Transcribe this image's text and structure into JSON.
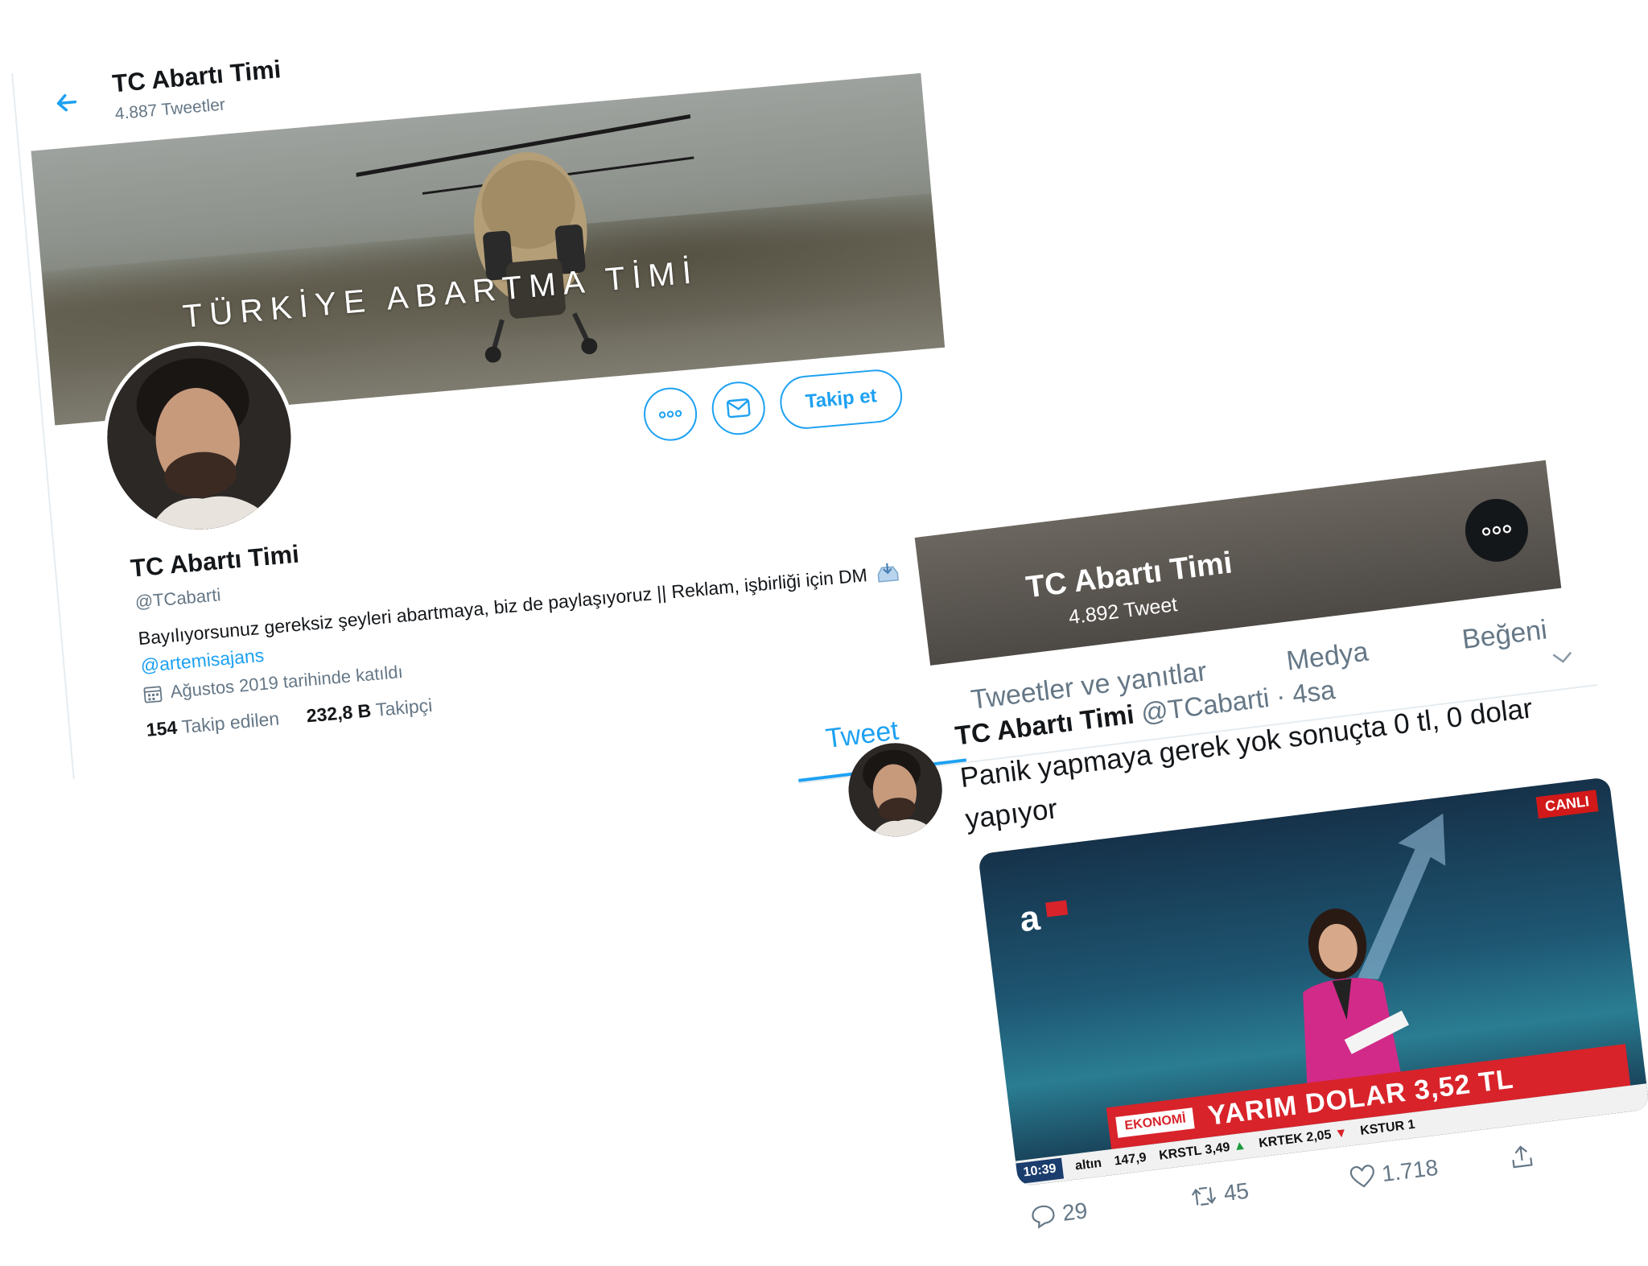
{
  "profile": {
    "header_title": "TC Abartı Timi",
    "header_tweet_count": "4.887 Tweetler",
    "banner_text": "TÜRKİYE ABARTMA TİMİ",
    "follow_label": "Takip et",
    "name": "TC Abartı Timi",
    "handle": "@TCabarti",
    "bio_text": "Bayılıyorsunuz gereksiz şeyleri abartmaya, biz de paylaşıyoruz || Reklam, işbirliği için DM",
    "bio_mention": "@artemisajans",
    "joined": "Ağustos 2019 tarihinde katıldı",
    "following_count": "154",
    "following_label": "Takip edilen",
    "followers_count": "232,8 B",
    "followers_label": "Takipçi"
  },
  "tweet_view": {
    "header_title": "TC Abartı Timi",
    "header_tweet_count": "4.892 Tweet",
    "tabs": [
      {
        "label": "Tweet",
        "active": true
      },
      {
        "label": "Tweetler ve yanıtlar",
        "active": false
      },
      {
        "label": "Medya",
        "active": false
      },
      {
        "label": "Beğeni",
        "active": false
      }
    ],
    "tweet": {
      "author_name": "TC Abartı Timi",
      "author_handle": "@TCabarti",
      "time": "· 4sa",
      "text": "Panik yapmaya gerek yok sonuçta 0 tl, 0 dolar yapıyor",
      "media": {
        "live_badge": "CANLI",
        "segment": "EKONOMİ",
        "headline": "YARIM DOLAR 3,52 TL",
        "ticker_time": "10:39",
        "ticker_items": [
          "altın",
          "147,9",
          "KRSTL 3,49",
          "KRTEK 2,05",
          "KSTUR 1"
        ]
      },
      "replies": "29",
      "retweets": "45",
      "likes": "1.718"
    }
  },
  "colors": {
    "accent": "#1da1f2",
    "text": "#14171a",
    "muted": "#657786",
    "news_red": "#d8232a"
  }
}
